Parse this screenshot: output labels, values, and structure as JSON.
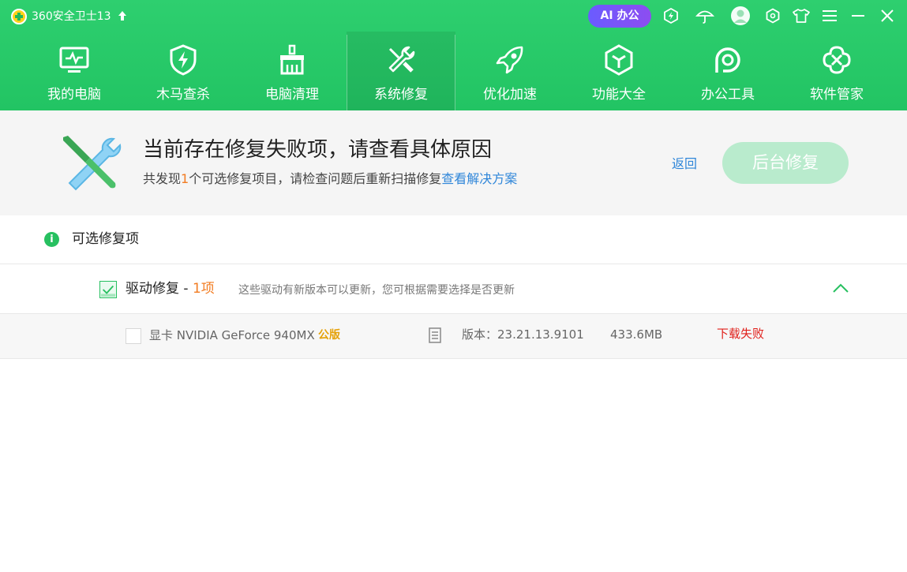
{
  "window": {
    "title": "360安全卫士13",
    "ai_button": "AI 办公",
    "icons": [
      "upgrade-arrow-icon",
      "shield-badge-icon",
      "umbrella-icon",
      "avatar-icon",
      "settings-icon",
      "skin-icon",
      "menu-icon",
      "minimize-icon",
      "close-icon"
    ]
  },
  "nav": {
    "items": [
      {
        "label": "我的电脑",
        "icon": "monitor-icon"
      },
      {
        "label": "木马查杀",
        "icon": "shield-icon"
      },
      {
        "label": "电脑清理",
        "icon": "broom-icon"
      },
      {
        "label": "系统修复",
        "icon": "wrench-icon",
        "active": true
      },
      {
        "label": "优化加速",
        "icon": "rocket-icon"
      },
      {
        "label": "功能大全",
        "icon": "cube-icon"
      },
      {
        "label": "办公工具",
        "icon": "office-p-icon"
      },
      {
        "label": "软件管家",
        "icon": "apps-icon"
      }
    ]
  },
  "banner": {
    "title": "当前存在修复失败项，请查看具体原因",
    "subtitle_prefix": "共发现",
    "count": "1",
    "subtitle_middle": "个可选修复项目，请检查问题后重新扫描修复",
    "solution_link": "查看解决方案",
    "back_link": "返回",
    "repair_button": "后台修复"
  },
  "section": {
    "title": "可选修复项"
  },
  "group": {
    "title": "驱动修复",
    "separator": " - ",
    "count_label": "1项",
    "description": "这些驱动有新版本可以更新，您可根据需要选择是否更新"
  },
  "items": [
    {
      "name": "显卡 NVIDIA GeForce 940MX",
      "tag": "公版",
      "version": "版本：23.21.13.9101",
      "size": "433.6MB",
      "status": "下载失败"
    }
  ],
  "colors": {
    "brand_green": "#27c060",
    "header_green": "#2ecf6f",
    "ai_purple": "#7a55f5",
    "orange": "#f27c22",
    "link_blue": "#2f86d9",
    "error_red": "#e0201b"
  }
}
